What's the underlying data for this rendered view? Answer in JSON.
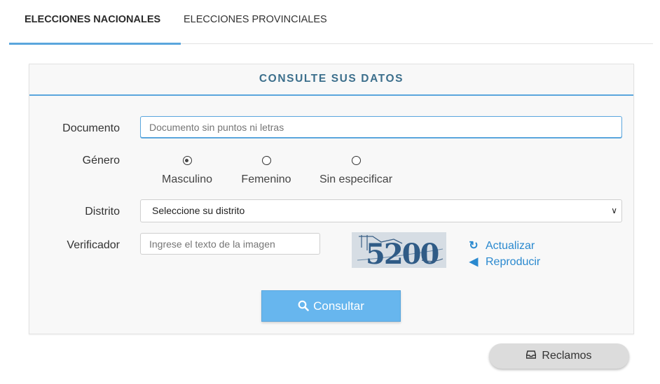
{
  "tabs": [
    {
      "label": "ELECCIONES NACIONALES",
      "active": true
    },
    {
      "label": "ELECCIONES PROVINCIALES",
      "active": false
    }
  ],
  "form": {
    "header": "CONSULTE SUS DATOS",
    "documento": {
      "label": "Documento",
      "placeholder": "Documento sin puntos ni letras"
    },
    "genero": {
      "label": "Género",
      "options": [
        "Masculino",
        "Femenino",
        "Sin especificar"
      ],
      "selected": "Masculino"
    },
    "distrito": {
      "label": "Distrito",
      "selected": "Seleccione su distrito"
    },
    "verificador": {
      "label": "Verificador",
      "placeholder": "Ingrese el texto de la imagen",
      "captcha_text": "5200",
      "refresh_label": "Actualizar",
      "audio_label": "Reproducir"
    },
    "submit_label": "Consultar"
  },
  "reclamos_label": "Reclamos",
  "colors": {
    "accent": "#5aa6dd",
    "button": "#67b6ee",
    "header_text": "#3c6f8c",
    "link": "#2a89cf"
  },
  "icons": {
    "submit": "search-icon",
    "refresh": "refresh-icon",
    "audio": "volume-icon",
    "reclamos": "inbox-icon"
  }
}
